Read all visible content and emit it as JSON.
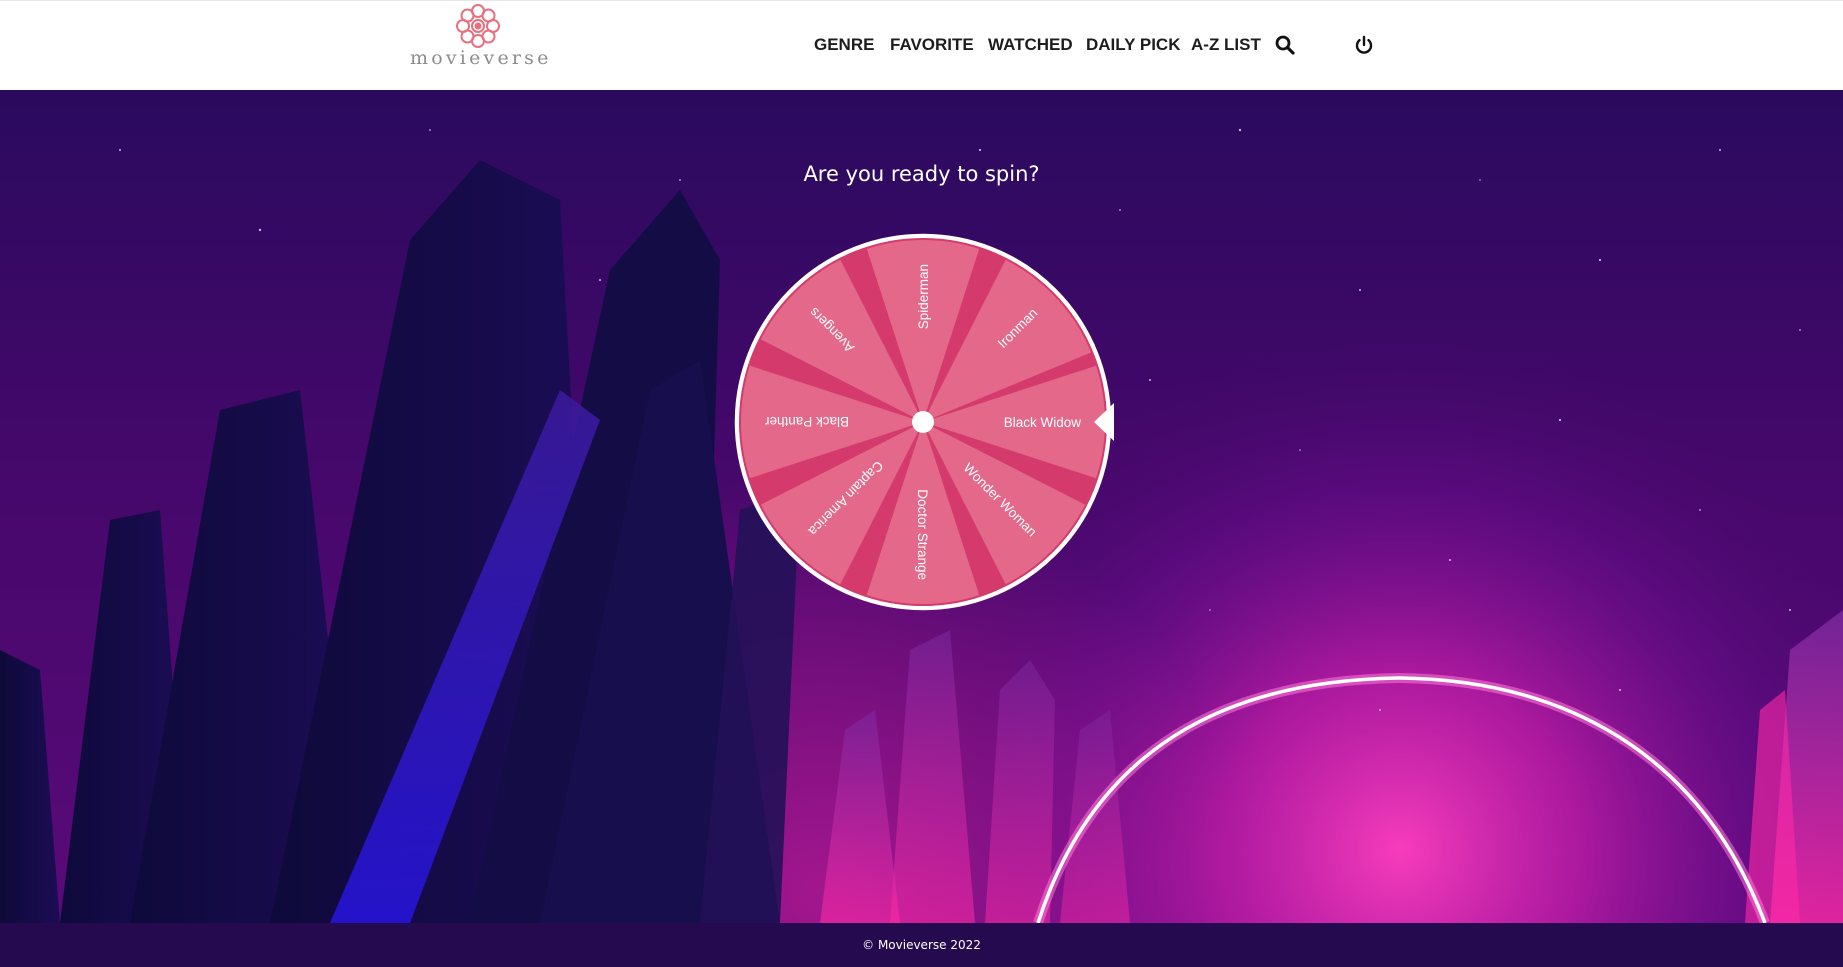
{
  "brand": {
    "name": "movieverse",
    "logo_icon": "flower-logo-icon",
    "accent": "#e8707f"
  },
  "nav": {
    "items": [
      {
        "label": "GENRE"
      },
      {
        "label": "FAVORITE"
      },
      {
        "label": "WATCHED"
      },
      {
        "label": "DAILY PICK"
      },
      {
        "label": "A-Z LIST"
      }
    ],
    "search_icon": "search-icon",
    "power_icon": "power-icon"
  },
  "hero": {
    "title": "Are you ready to spin?",
    "background_colors": [
      "#1e0a4a",
      "#4a0a6a",
      "#ff2fb4"
    ]
  },
  "wheel": {
    "segments": [
      "Black Widow",
      "Wonder Woman",
      "Doctor Strange",
      "Captain America",
      "Black Panther",
      "Avengers",
      "Spiderman",
      "Ironman"
    ],
    "pointer_icon": "wheel-pointer-icon",
    "segment_color": "#e3688a",
    "separator_color": "#d43a6b",
    "rim_color": "#ffffff"
  },
  "footer": {
    "copyright": "© Movieverse 2022"
  }
}
